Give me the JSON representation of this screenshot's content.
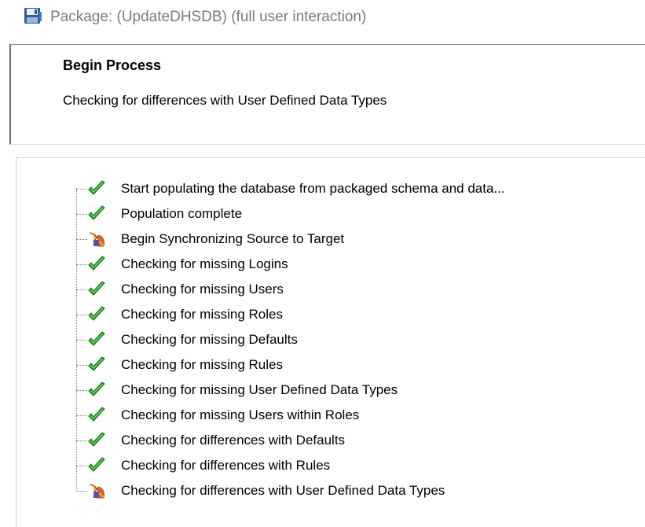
{
  "window": {
    "title": "Package: (UpdateDHSDB) (full user interaction)",
    "icon": "floppy-disk-icon"
  },
  "status": {
    "heading": "Begin Process",
    "message": "Checking for differences with User Defined Data Types"
  },
  "colors": {
    "check": "#1aa31a",
    "in_progress": "#e2691c"
  },
  "steps": [
    {
      "label": "Start populating the database from packaged schema and data...",
      "status": "complete",
      "icon": "green-check-icon"
    },
    {
      "label": "Population complete",
      "status": "complete",
      "icon": "green-check-icon"
    },
    {
      "label": "Begin Synchronizing Source to Target",
      "status": "in-progress",
      "icon": "running-task-icon"
    },
    {
      "label": "Checking for missing Logins",
      "status": "complete",
      "icon": "green-check-icon"
    },
    {
      "label": "Checking for missing Users",
      "status": "complete",
      "icon": "green-check-icon"
    },
    {
      "label": "Checking for missing Roles",
      "status": "complete",
      "icon": "green-check-icon"
    },
    {
      "label": "Checking for missing Defaults",
      "status": "complete",
      "icon": "green-check-icon"
    },
    {
      "label": "Checking for missing Rules",
      "status": "complete",
      "icon": "green-check-icon"
    },
    {
      "label": "Checking for missing User Defined Data Types",
      "status": "complete",
      "icon": "green-check-icon"
    },
    {
      "label": "Checking for missing Users within Roles",
      "status": "complete",
      "icon": "green-check-icon"
    },
    {
      "label": "Checking for differences with Defaults",
      "status": "complete",
      "icon": "green-check-icon"
    },
    {
      "label": "Checking for differences with Rules",
      "status": "complete",
      "icon": "green-check-icon"
    },
    {
      "label": "Checking for differences with User Defined Data Types",
      "status": "in-progress",
      "icon": "running-task-icon"
    }
  ]
}
